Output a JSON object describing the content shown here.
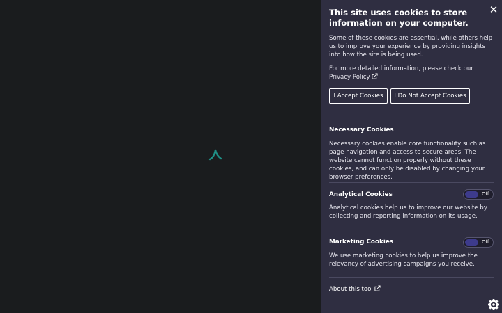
{
  "banner": {
    "title": "This site uses cookies to store information on your computer.",
    "intro": "Some of these cookies are essential, while others help us to improve your experience by providing insights into how the site is being used.",
    "privacy_text": "For more detailed information, please check our Privacy Policy",
    "accept_label": "I Accept Cookies",
    "decline_label": "I Do Not Accept Cookies",
    "close_label": "✕"
  },
  "sections": {
    "necessary": {
      "title": "Necessary Cookies",
      "description": "Necessary cookies enable core functionality such as page navigation and access to secure areas. The website cannot function properly without these cookies, and can only be disabled by changing your browser preferences."
    },
    "analytical": {
      "title": "Analytical Cookies",
      "toggle_state": "Off",
      "description": "Analytical cookies help us to improve our website by collecting and reporting information on its usage."
    },
    "marketing": {
      "title": "Marketing Cookies",
      "toggle_state": "Off",
      "description": "We use marketing cookies to help us improve the relevancy of advertising campaigns you receive."
    }
  },
  "footer": {
    "about_label": "About this tool"
  },
  "colors": {
    "panel_bg": "#2f2e41",
    "page_bg": "#1a1c1e",
    "spinner": "#1f8f86",
    "toggle_knob": "#3d3b8c"
  },
  "icons": {
    "close": "close-icon",
    "external_link": "external-link-icon",
    "settings": "gear-icon",
    "loading": "spinner-icon"
  }
}
